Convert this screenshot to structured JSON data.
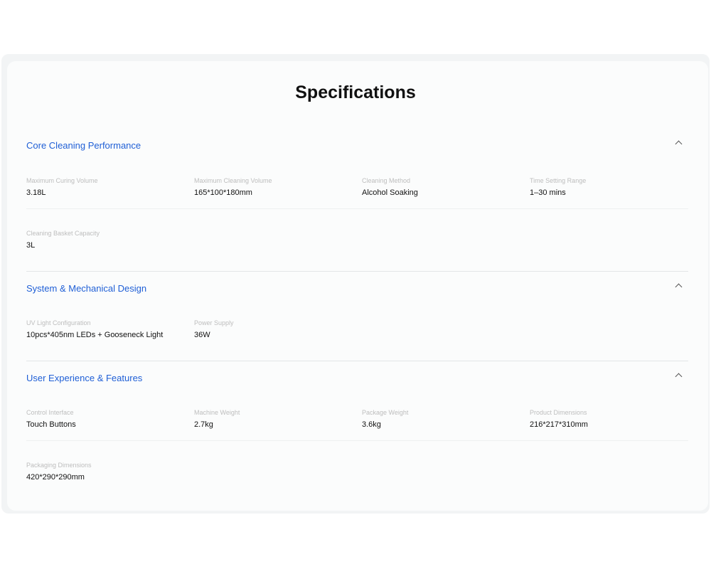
{
  "page": {
    "title": "Specifications"
  },
  "sections": [
    {
      "title": "Core Cleaning Performance",
      "specs": [
        {
          "label": "Maximum Curing Volume",
          "value": "3.18L"
        },
        {
          "label": "Maximum Cleaning Volume",
          "value": "165*100*180mm"
        },
        {
          "label": "Cleaning Method",
          "value": "Alcohol Soaking"
        },
        {
          "label": "Time Setting Range",
          "value": "1–30 mins"
        },
        {
          "label": "Cleaning Basket Capacity",
          "value": "3L"
        }
      ]
    },
    {
      "title": "System & Mechanical Design",
      "specs": [
        {
          "label": "UV Light Configuration",
          "value": "10pcs*405nm LEDs + Gooseneck Light"
        },
        {
          "label": "Power Supply",
          "value": "36W"
        }
      ]
    },
    {
      "title": "User Experience & Features",
      "specs": [
        {
          "label": "Control Interface",
          "value": "Touch Buttons"
        },
        {
          "label": "Machine Weight",
          "value": "2.7kg"
        },
        {
          "label": "Package Weight",
          "value": "3.6kg"
        },
        {
          "label": "Product Dimensions",
          "value": "216*217*310mm"
        },
        {
          "label": "Packaging Dimensions",
          "value": "420*290*290mm"
        }
      ]
    }
  ],
  "icons": {
    "collapse": "chevron-up-icon"
  },
  "colors": {
    "section_title": "#1f5fd6",
    "label": "#bdbdbd",
    "value": "#111111"
  }
}
